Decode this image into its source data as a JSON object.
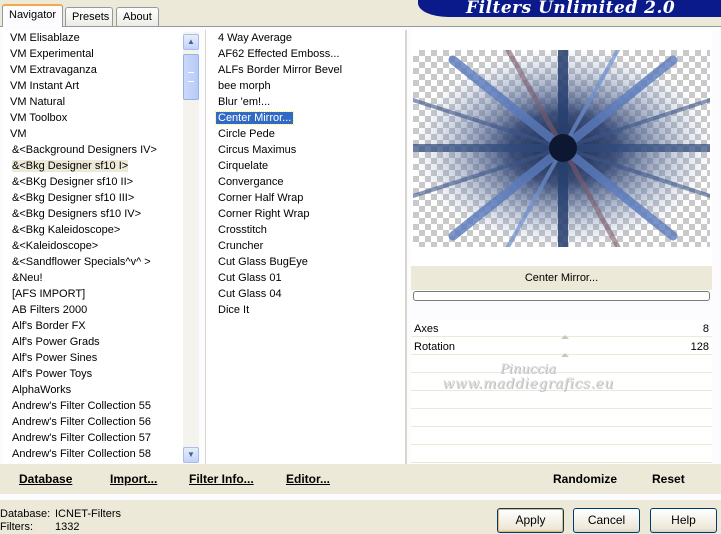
{
  "tabs": [
    {
      "label": "Navigator",
      "active": true
    },
    {
      "label": "Presets",
      "active": false
    },
    {
      "label": "About",
      "active": false
    }
  ],
  "brand_title": "Filters Unlimited 2.0",
  "categories": [
    "VM Elisablaze",
    "VM Experimental",
    "VM Extravaganza",
    "VM Instant Art",
    "VM Natural",
    "VM Toolbox",
    "VM",
    "&<Background Designers IV>",
    "&<Bkg Designer sf10 I>",
    "&<BKg Designer sf10 II>",
    "&<Bkg Designer sf10 III>",
    "&<Bkg Designers sf10 IV>",
    "&<Bkg Kaleidoscope>",
    "&<Kaleidoscope>",
    "&<Sandflower Specials^v^ >",
    "&Neu!",
    "[AFS IMPORT]",
    "AB Filters 2000",
    "Alf's Border FX",
    "Alf's Power Grads",
    "Alf's Power Sines",
    "Alf's Power Toys",
    "AlphaWorks",
    "Andrew's Filter Collection 55",
    "Andrew's Filter Collection 56",
    "Andrew's Filter Collection 57",
    "Andrew's Filter Collection 58"
  ],
  "selected_category": "&<Bkg Designer sf10 I>",
  "filters": [
    "4 Way Average",
    "AF62 Effected Emboss...",
    "ALFs Border Mirror Bevel",
    "bee morph",
    "Blur 'em!...",
    "Center Mirror...",
    "Circle Pede",
    "Circus Maximus",
    "Cirquelate",
    "Convergance",
    "Corner Half Wrap",
    "Corner Right Wrap",
    "Crosstitch",
    "Cruncher",
    "Cut Glass  BugEye",
    "Cut Glass 01",
    "Cut Glass 04",
    "Dice It"
  ],
  "selected_filter": "Center Mirror...",
  "current_filter_name": "Center Mirror...",
  "progress": 0,
  "params": [
    {
      "label": "Axes",
      "value": "8"
    },
    {
      "label": "Rotation",
      "value": "128"
    }
  ],
  "watermark": {
    "line1": "Pinuccia",
    "line2": "www.maddiegrafics.eu"
  },
  "links": {
    "database": "Database",
    "import": "Import...",
    "filter_info": "Filter Info...",
    "editor": "Editor...",
    "randomize": "Randomize",
    "reset": "Reset"
  },
  "status": {
    "database_label": "Database:",
    "database_value": "ICNET-Filters",
    "filters_label": "Filters:",
    "filters_value": "1332"
  },
  "buttons": {
    "apply": "Apply",
    "cancel": "Cancel",
    "help": "Help"
  },
  "colors": {
    "selection": "#316ac5",
    "brand_bar": "#0a1a8a",
    "dialog_bg": "#ece9d8"
  },
  "icons": {
    "scroll_up": "scroll-up-arrow",
    "scroll_down": "scroll-down-arrow"
  }
}
